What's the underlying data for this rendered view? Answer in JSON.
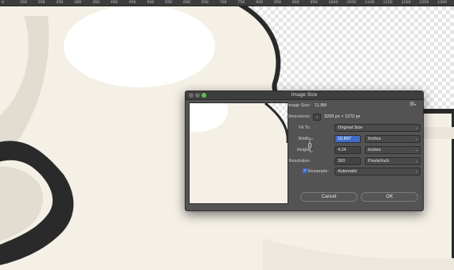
{
  "ruler": {
    "ticks": [
      "0",
      "150",
      "200",
      "250",
      "300",
      "350",
      "400",
      "450",
      "500",
      "550",
      "600",
      "650",
      "700",
      "750",
      "800",
      "850",
      "900",
      "950",
      "1000",
      "1050",
      "1100",
      "1150",
      "1200",
      "1250",
      "1300"
    ]
  },
  "dialog": {
    "title": "Image Size",
    "image_size_label": "Image Size:",
    "image_size_value": "11.9M",
    "dimensions_label": "Dimensions:",
    "dimensions_value": "3269 px × 1272 px",
    "fit_to_label": "Fit To:",
    "fit_to_value": "Original Size",
    "width_label": "Width:",
    "width_value": "10.897",
    "width_unit": "Inches",
    "height_label": "Height:",
    "height_value": "4.24",
    "height_unit": "Inches",
    "resolution_label": "Resolution:",
    "resolution_value": "300",
    "resolution_unit": "Pixels/Inch",
    "resample_label": "Resample:",
    "resample_checked": true,
    "resample_value": "Automatic",
    "cancel_label": "Cancel",
    "ok_label": "OK"
  },
  "icons": {
    "gear": "gear-icon",
    "link": "link-chain-icon",
    "chevron": "chevron-down-icon",
    "check": "checkmark-icon"
  },
  "colors": {
    "artwork_fill": "#f4f0e6",
    "artwork_shadow": "#e2ddd0",
    "artwork_outline": "#2a2a2a",
    "dialog_bg": "#535353",
    "selection": "#3f6dcb",
    "zoom_button": "#5fbf4a"
  }
}
